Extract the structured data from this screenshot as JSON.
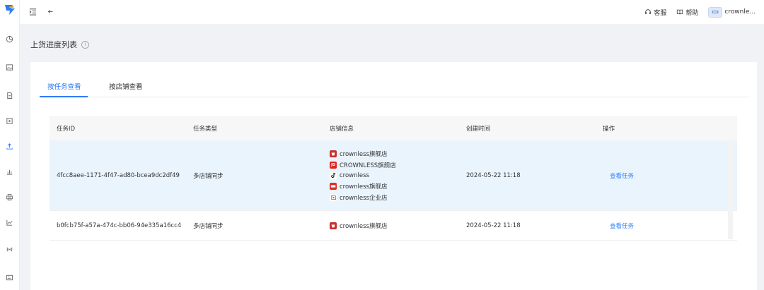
{
  "logo": {
    "icon": "logo-icon"
  },
  "sidebar": {
    "items": [
      {
        "icon": "dashboard-icon"
      },
      {
        "icon": "image-icon"
      },
      {
        "icon": "document-icon"
      },
      {
        "icon": "play-icon"
      },
      {
        "icon": "upload-icon",
        "active": true
      },
      {
        "icon": "bar-chart-icon"
      },
      {
        "icon": "printer-icon"
      },
      {
        "icon": "line-chart-icon"
      },
      {
        "icon": "signal-icon"
      },
      {
        "icon": "card-icon"
      }
    ]
  },
  "topbar": {
    "service_label": "客服",
    "help_label": "帮助",
    "user_name": "crownle..."
  },
  "page": {
    "title": "上货进度列表"
  },
  "tabs": {
    "items": [
      {
        "label": "按任务查看",
        "active": true
      },
      {
        "label": "按店铺查看",
        "active": false
      }
    ]
  },
  "table": {
    "headers": {
      "task_id": "任务ID",
      "task_type": "任务类型",
      "store_info": "店铺信息",
      "created_at": "创建时间",
      "action": "操作"
    },
    "rows": [
      {
        "task_id": "4fcc8aee-1171-4f47-ad80-bcea9dc2df49",
        "task_type": "多店铺同步",
        "stores": [
          {
            "platform": "red",
            "name": "crownless旗舰店"
          },
          {
            "platform": "jd",
            "badge": "JD",
            "name": "CROWNLESS旗舰店"
          },
          {
            "platform": "tiktok",
            "name": "crownless"
          },
          {
            "platform": "pdd",
            "name": "crownless旗舰店"
          },
          {
            "platform": "weidian",
            "name": "crownless企业店"
          }
        ],
        "created_at": "2024-05-22 11:18",
        "action": "查看任务"
      },
      {
        "task_id": "b0fcb75f-a57a-474c-bb06-94e335a16cc4",
        "task_type": "多店铺同步",
        "stores": [
          {
            "platform": "red",
            "name": "crownless旗舰店"
          }
        ],
        "created_at": "2024-05-22 11:18",
        "action": "查看任务"
      }
    ]
  },
  "colors": {
    "accent": "#2e7cf6",
    "row_highlight": "#eaf4fd",
    "background": "#f0f2f5"
  }
}
